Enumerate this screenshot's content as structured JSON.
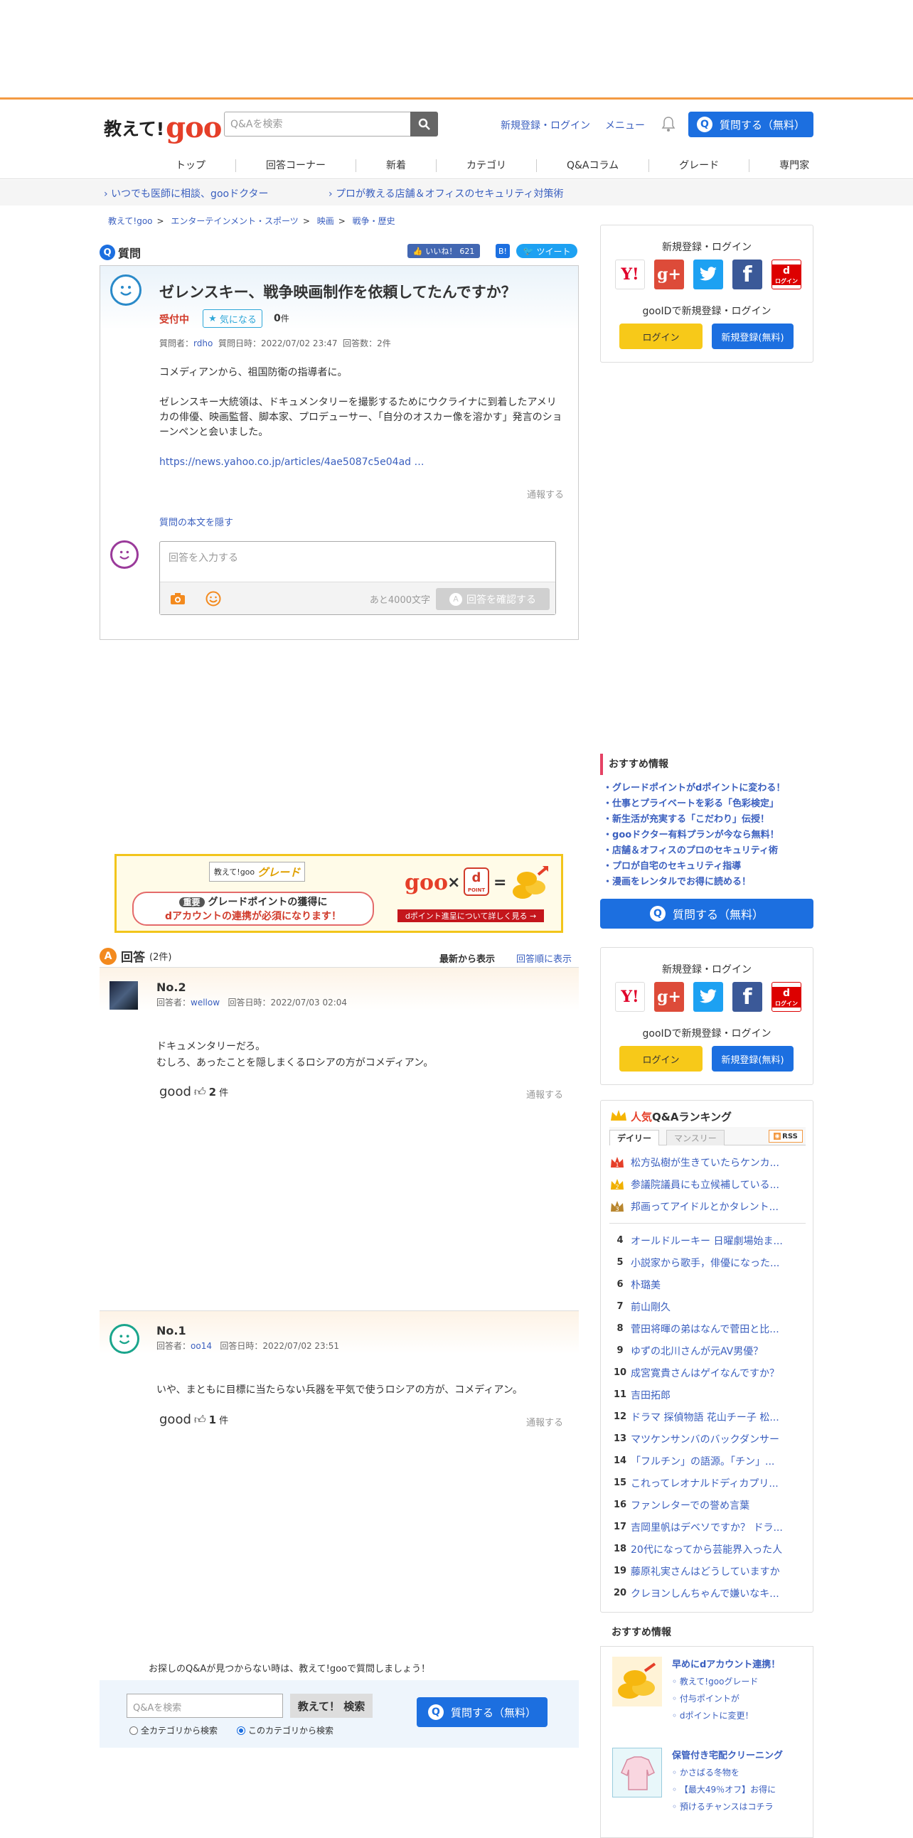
{
  "header": {
    "logo_main": "教えて!",
    "logo_goo": "goo",
    "search_placeholder": "Q&Aを検索",
    "register_login": "新規登録・ログイン",
    "menu": "メニュー",
    "ask_button": "質問する（無料）"
  },
  "nav": [
    "トップ",
    "回答コーナー",
    "新着",
    "カテゴリ",
    "Q&Aコラム",
    "グレード",
    "専門家"
  ],
  "promo": [
    "いつでも医師に相談、gooドクター",
    "プロが教える店舗＆オフィスのセキュリティ対策術"
  ],
  "breadcrumb": [
    "教えて!goo",
    "エンターテインメント・スポーツ",
    "映画",
    "戦争・歴史"
  ],
  "question": {
    "header": "質問",
    "like_label": "いいね！",
    "like_count": "621",
    "tweet": "ツイート",
    "title": "ゼレンスキー、戦争映画制作を依頼してたんですか？",
    "status": "受付中",
    "watch": "気になる",
    "watch_count": "0",
    "watch_unit": "件",
    "meta": "質問者：",
    "asker": "rdho",
    "date": "質問日時：2022/07/02 23:47",
    "answers": "回答数：2件",
    "body1": "コメディアンから、祖国防衛の指導者に。",
    "body2": "ゼレンスキー大統領は、ドキュメンタリーを撮影するためにウクライナに到着したアメリカの俳優、映画監督、脚本家、プロデューサー、「自分のオスカー像を溶かす」発言のショーンペンと会いました。",
    "link": "https://news.yahoo.co.jp/articles/4ae5087c5e04ad …",
    "report": "通報する",
    "hide": "質問の本文を隠す",
    "answer_placeholder": "回答を入力する",
    "chars_left": "あと4000文字",
    "confirm": "回答を確認する"
  },
  "banner": {
    "tag": "教えて!goo",
    "grade": "グレード",
    "important": "重要",
    "line1": "グレードポイントの獲得に",
    "line2": "dアカウントの連携が必須になります！",
    "dpoint": "POINT",
    "cta": "dポイント進呈について詳しく見る →",
    "times": "×",
    "eq": "="
  },
  "answers_section": {
    "title": "回答",
    "count": "(2件)",
    "sort_new": "最新から表示",
    "sort_old": "回答順に表示"
  },
  "answers": [
    {
      "no": "No.2",
      "user_label": "回答者：",
      "user": "wellow",
      "date": "回答日時：2022/07/03 02:04",
      "body1": "ドキュメンタリーだろ。",
      "body2": "むしろ、あったことを隠しまくるロシアの方がコメディアン。",
      "good": "good",
      "count": "2",
      "unit": "件",
      "report": "通報する"
    },
    {
      "no": "No.1",
      "user_label": "回答者：",
      "user": "oo14",
      "date": "回答日時：2022/07/02 23:51",
      "body1": "いや、まともに目標に当たらない兵器を平気で使うロシアの方が、コメディアン。",
      "good": "good",
      "count": "1",
      "unit": "件",
      "report": "通報する"
    }
  ],
  "sidebar": {
    "login_title": "新規登録・ログイン",
    "goo_id": "gooIDで新規登録・ログイン",
    "login": "ログイン",
    "register": "新規登録(無料)",
    "d_login": "ログイン",
    "rec_title": "おすすめ情報",
    "rec_items": [
      "グレードポイントがdポイントに変わる！",
      "仕事とプライベートを彩る「色彩検定」",
      "新生活が充実する「こだわり」伝授！",
      "gooドクター有料プランが今なら無料！",
      "店舗＆オフィスのプロのセキュリティ術",
      "プロが自宅のセキュリティ指導",
      "漫画をレンタルでお得に読める！"
    ],
    "ask": "質問する（無料）",
    "rank_title_pop": "人気",
    "rank_title": "Q&Aランキング",
    "daily": "デイリー",
    "monthly": "マンスリー",
    "rss": "RSS",
    "rank": [
      {
        "n": "1",
        "t": "松方弘樹が生きていたらケンカ..."
      },
      {
        "n": "2",
        "t": "参議院議員にも立候補している..."
      },
      {
        "n": "3",
        "t": "邦画ってアイドルとかタレント..."
      },
      {
        "n": "4",
        "t": "オールドルーキー 日曜劇場始ま..."
      },
      {
        "n": "5",
        "t": "小説家から歌手，俳優になった..."
      },
      {
        "n": "6",
        "t": "朴璐美"
      },
      {
        "n": "7",
        "t": "前山剛久"
      },
      {
        "n": "8",
        "t": "菅田将暉の弟はなんで菅田と比..."
      },
      {
        "n": "9",
        "t": "ゆずの北川さんが元AV男優？"
      },
      {
        "n": "10",
        "t": "成宮寛貴さんはゲイなんですか？"
      },
      {
        "n": "11",
        "t": "吉田拓郎"
      },
      {
        "n": "12",
        "t": "ドラマ 探偵物語 花山チー子 松..."
      },
      {
        "n": "13",
        "t": "マツケンサンバのバックダンサー"
      },
      {
        "n": "14",
        "t": "「フルチン」の語源。「チン」..."
      },
      {
        "n": "15",
        "t": "これってレオナルドディカプリ..."
      },
      {
        "n": "16",
        "t": "ファンレターでの誉め言葉"
      },
      {
        "n": "17",
        "t": "吉岡里帆はデベソですか？ ドラ..."
      },
      {
        "n": "18",
        "t": "20代になってから芸能界入った人"
      },
      {
        "n": "19",
        "t": "藤原礼実さんはどうしていますか"
      },
      {
        "n": "20",
        "t": "クレヨンしんちゃんで嫌いなキ..."
      }
    ],
    "rec2_title": "おすすめ情報",
    "rec2_a_title": "早めにdアカウント連携！",
    "rec2_a": [
      "教えて!gooグレード",
      "付与ポイントが",
      "dポイントに変更！"
    ],
    "rec2_b_title": "保管付き宅配クリーニング",
    "rec2_b": [
      "かさばる冬物を",
      "【最大49％オフ】お得に",
      "預けるチャンスはコチラ"
    ]
  },
  "footer": {
    "prompt": "お探しのQ&Aが見つからない時は、教えて!gooで質問しましょう！",
    "search_placeholder": "Q&Aを検索",
    "search_btn": "教えて！ 検索",
    "all": "全カテゴリから検索",
    "this": "このカテゴリから検索",
    "ask": "質問する（無料）"
  }
}
